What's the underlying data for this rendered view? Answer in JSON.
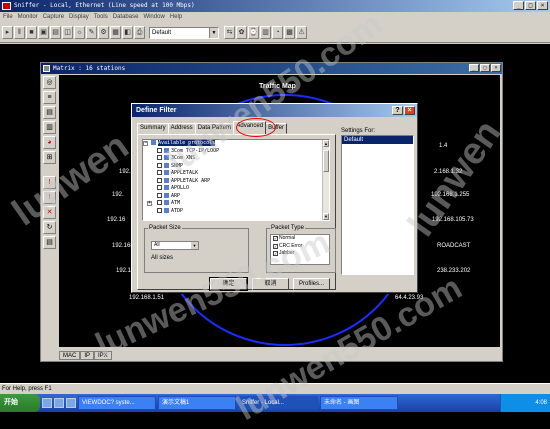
{
  "window": {
    "title": "Sniffer - Local, Ethernet (Line speed at 100 Mbps)",
    "min": "_",
    "max": "□",
    "close": "×"
  },
  "menubar": [
    "File",
    "Monitor",
    "Capture",
    "Display",
    "Tools",
    "Database",
    "Window",
    "Help"
  ],
  "toolbar": {
    "profile_combo": "Default"
  },
  "matrix": {
    "title": "Matrix : 16 stations",
    "map_title": "Traffic Map",
    "ips": [
      {
        "text": "1.4",
        "pos": "ip1"
      },
      {
        "text": "2.168.1.32",
        "pos": "ip2"
      },
      {
        "text": "192.",
        "pos": "ip3"
      },
      {
        "text": "192.168.1.255",
        "pos": "ip4"
      },
      {
        "text": "192.",
        "pos": "ip5"
      },
      {
        "text": "192.168.105.73",
        "pos": "ip6"
      },
      {
        "text": "192.16",
        "pos": "ip7"
      },
      {
        "text": "192.168",
        "pos": "ip8"
      },
      {
        "text": "ROADCAST",
        "pos": "ip9"
      },
      {
        "text": "192.1",
        "pos": "ip10"
      },
      {
        "text": "238.233.202",
        "pos": "ip11"
      },
      {
        "text": "192.168.1.51",
        "pos": "ip12"
      },
      {
        "text": "64.4.23.93",
        "pos": "ip13"
      }
    ],
    "tabs": [
      "MAC",
      "IP",
      "IPX"
    ]
  },
  "dialog": {
    "title": "Define Filter",
    "help": "?",
    "close": "×",
    "tabs": [
      "Summary",
      "Address",
      "Data Pattern",
      "Advanced",
      "Buffer"
    ],
    "selected_tab": "Advanced",
    "tree_root": "Available protocols",
    "protocols": [
      {
        "label": "3Com TCP-IP/LOOP",
        "expandable": false
      },
      {
        "label": "3Com XNS",
        "expandable": false
      },
      {
        "label": "SNMP",
        "expandable": false
      },
      {
        "label": "APPLETALK",
        "expandable": false
      },
      {
        "label": "APPLETALK ARP",
        "expandable": false
      },
      {
        "label": "APOLLO",
        "expandable": false
      },
      {
        "label": "ARP",
        "expandable": false
      },
      {
        "label": "ATM",
        "expandable": true
      },
      {
        "label": "ATDP",
        "expandable": false
      }
    ],
    "packet_size": {
      "legend": "Packet Size",
      "value": "All",
      "text": "All sizes"
    },
    "packet_type": {
      "legend": "Packet Type",
      "items": [
        {
          "label": "Normal",
          "checked": true
        },
        {
          "label": "CRC Error",
          "checked": true
        },
        {
          "label": "Jabber",
          "checked": true
        }
      ]
    },
    "settings_for": {
      "label": "Settings For:",
      "items": [
        "Default"
      ]
    },
    "buttons": {
      "ok": "确定",
      "cancel": "取消",
      "profiles": "Profiles..."
    }
  },
  "statusbar": {
    "text": "For Help, press F1"
  },
  "taskbar": {
    "start": "开始",
    "items": [
      {
        "label": "VIEWDOC? syste...",
        "active": false
      },
      {
        "label": "演示文稿1",
        "active": false
      },
      {
        "label": "Sniffer - Local...",
        "active": true
      },
      {
        "label": "未命名 - 画图",
        "active": false
      }
    ],
    "clock": "4:08"
  },
  "watermarks": [
    "lunwen550.com",
    "lunwen550.com",
    "lunwen550.com",
    "lunwen",
    "lunwen"
  ],
  "colors": {
    "titlebar": "#0a246a",
    "map_circle": "#1a2cff",
    "highlight": "#0a246a",
    "annotation": "#ee0000"
  }
}
